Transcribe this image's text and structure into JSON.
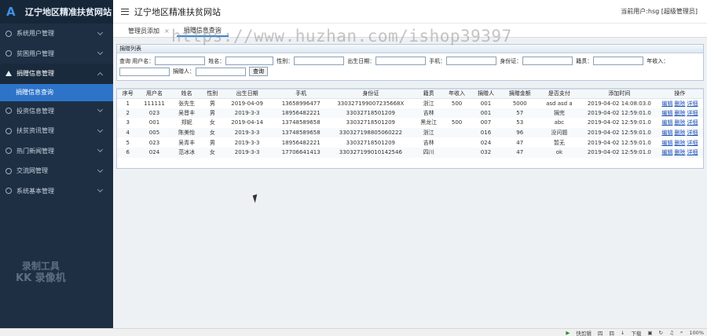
{
  "sidebar": {
    "logo_letter": "A",
    "title": "辽宁地区精准扶贫网站",
    "items": [
      {
        "label": "系统用户管理",
        "open": false
      },
      {
        "label": "贫困用户管理",
        "open": false
      },
      {
        "label": "捐赠信息管理",
        "open": true
      },
      {
        "label": "投资信息管理",
        "open": false
      },
      {
        "label": "扶贫资讯管理",
        "open": false
      },
      {
        "label": "热门新闻管理",
        "open": false
      },
      {
        "label": "交流网管理",
        "open": false
      },
      {
        "label": "系统基本管理",
        "open": false
      }
    ],
    "sub_item": "捐赠信息查询",
    "recorder_line1": "录制工具",
    "recorder_line2": "KK 录像机"
  },
  "header": {
    "title": "辽宁地区精准扶贫网站",
    "current_user": "当前用户:hsg [超级管理员]"
  },
  "tabs": [
    {
      "label": "管理员添加",
      "active": false,
      "close": "×"
    },
    {
      "label": "捐赠信息查询",
      "active": true,
      "close": ""
    }
  ],
  "search": {
    "title": "捐赠列表",
    "fields": [
      {
        "label": "查询 用户名：",
        "value": ""
      },
      {
        "label": "姓名：",
        "value": ""
      },
      {
        "label": "性别：",
        "value": ""
      },
      {
        "label": "出生日期：",
        "value": ""
      },
      {
        "label": "手机：",
        "value": ""
      },
      {
        "label": "身份证：",
        "value": ""
      },
      {
        "label": "籍贯：",
        "value": ""
      },
      {
        "label": "年收入：",
        "value": ""
      },
      {
        "label": "捐赠人：",
        "value": ""
      }
    ],
    "button": "查询"
  },
  "table": {
    "headers": [
      "序号",
      "用户名",
      "姓名",
      "性别",
      "出生日期",
      "手机",
      "身份证",
      "籍贯",
      "年收入",
      "捐赠人",
      "捐赠金额",
      "是否支付",
      "添加时间",
      "操作"
    ],
    "rows": [
      [
        "1",
        "111111",
        "张先生",
        "男",
        "2019-04-09",
        "13658996477",
        "330327199007235668X",
        "浙江",
        "500",
        "001",
        "5000",
        "asd asd a",
        "2019-04-02 14:08:03.0"
      ],
      [
        "2",
        "023",
        "吴晋丰",
        "男",
        "2019-3-3",
        "18956482221",
        "330327185012​09",
        "吉林",
        "",
        "001",
        "57",
        "捐完",
        "2019-04-02 12:59:01.0"
      ],
      [
        "3",
        "001",
        "郑妮",
        "女",
        "2019-04-14",
        "13748589658",
        "330327185012​09",
        "黑龙江",
        "500",
        "007",
        "53",
        "abc",
        "2019-04-02 12:59:01.0"
      ],
      [
        "4",
        "005",
        "陈美怡",
        "女",
        "2019-3-3",
        "13748589658",
        "330327198805060222",
        "浙江",
        "",
        "016",
        "96",
        "没问题",
        "2019-04-02 12:59:01.0"
      ],
      [
        "5",
        "023",
        "吴青丰",
        "男",
        "2019-3-3",
        "18956482221",
        "330327185012​09",
        "吉林",
        "",
        "024",
        "47",
        "暂无",
        "2019-04-02 12:59:01.0"
      ],
      [
        "6",
        "024",
        "范冰冰",
        "女",
        "2019-3-3",
        "17706641413",
        "330327199010142546",
        "四川",
        "",
        "032",
        "47",
        "ok",
        "2019-04-02 12:59:01.0"
      ]
    ],
    "ops": [
      "编辑",
      "删除",
      "详细"
    ]
  },
  "watermark_url": "https://www.huzhan.com/ishop39397",
  "statusbar": {
    "items": [
      "快剪辑",
      "四",
      "四",
      "下载",
      "",
      "",
      "",
      "100%"
    ]
  },
  "colors": {
    "sidebar": "#1e2f44",
    "accent": "#2d74c9"
  }
}
